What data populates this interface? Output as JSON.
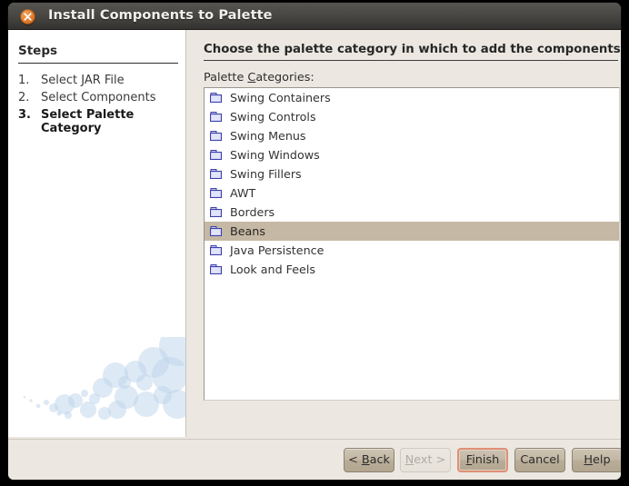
{
  "window": {
    "title": "Install Components to Palette",
    "close_icon": "close-icon"
  },
  "steps": {
    "title": "Steps",
    "items": [
      {
        "number": "1.",
        "label": "Select JAR File",
        "current": false
      },
      {
        "number": "2.",
        "label": "Select Components",
        "current": false
      },
      {
        "number": "3.",
        "label": "Select Palette Category",
        "current": true
      }
    ]
  },
  "main": {
    "heading": "Choose the palette category in which to add the components",
    "list_label_prefix": "Palette ",
    "list_label_mnemonic": "C",
    "list_label_suffix": "ategories:",
    "categories": [
      {
        "label": "Swing Containers",
        "selected": false
      },
      {
        "label": "Swing Controls",
        "selected": false
      },
      {
        "label": "Swing Menus",
        "selected": false
      },
      {
        "label": "Swing Windows",
        "selected": false
      },
      {
        "label": "Swing Fillers",
        "selected": false
      },
      {
        "label": "AWT",
        "selected": false
      },
      {
        "label": "Borders",
        "selected": false
      },
      {
        "label": "Beans",
        "selected": true
      },
      {
        "label": "Java Persistence",
        "selected": false
      },
      {
        "label": "Look and Feels",
        "selected": false
      }
    ],
    "folder_icon": "folder-icon"
  },
  "buttons": {
    "back": {
      "prefix": "< ",
      "mnemonic": "B",
      "suffix": "ack",
      "disabled": false,
      "focused": false
    },
    "next": {
      "prefix": "",
      "mnemonic": "N",
      "suffix": "ext >",
      "disabled": true,
      "focused": false
    },
    "finish": {
      "prefix": "",
      "mnemonic": "F",
      "suffix": "inish",
      "disabled": false,
      "focused": true
    },
    "cancel": {
      "prefix": "",
      "mnemonic": "",
      "suffix": "Cancel",
      "disabled": false,
      "focused": false
    },
    "help": {
      "prefix": "",
      "mnemonic": "H",
      "suffix": "elp",
      "disabled": false,
      "focused": false
    }
  },
  "colors": {
    "titlebar": "#4b4945",
    "close_button": "#e07b2a",
    "panel_background": "#ece8e1",
    "list_background": "#ffffff",
    "selection": "#c5b9a5",
    "button_face": "#c3b8a5",
    "focus_ring": "#e08f77",
    "bubble": "#bcd4ea"
  }
}
